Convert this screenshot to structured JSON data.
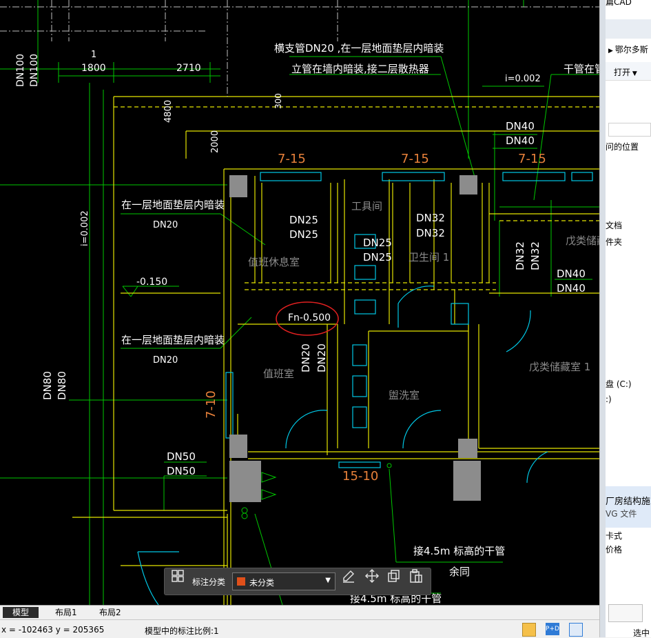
{
  "drawing": {
    "annotations": {
      "horiz_branch": "横支管DN20 ,在一层地面垫层内暗装",
      "riser": "立管在墙内暗装,接二层散热器",
      "main_pipe": "干管在管",
      "slope_top": "i=0.002",
      "slope_left": "i=0.002",
      "under_floor_1": "在一层地面垫层内暗装",
      "under_floor_2": "在一层地面垫层内暗装",
      "dn20_a": "DN20",
      "dn20_b": "DN20",
      "level_0150": "-0.150",
      "level_0500": "Fn-0.500",
      "connect_45m": "接4.5m 标高的干管",
      "same_below": "余同",
      "connect_45m_b": "接4.5m 标高的干管"
    },
    "dims": {
      "d1": "1",
      "d1800": "1800",
      "d2710": "2710",
      "d4800": "4800",
      "d300": "300",
      "d2000": "2000"
    },
    "pipes": {
      "dn100_a": "DN100",
      "dn100_b": "DN100",
      "dn40_a": "DN40",
      "dn40_b": "DN40",
      "dn25_a": "DN25",
      "dn25_b": "DN25",
      "dn32_a": "DN32",
      "dn32_b": "DN32",
      "dn25_c": "DN25",
      "dn25_d": "DN25",
      "dn32_v1": "DN32",
      "dn32_v2": "DN32",
      "dn40_c": "DN40",
      "dn40_d": "DN40",
      "dn20_v1": "DN20",
      "dn20_v2": "DN20",
      "dn80_a": "DN80",
      "dn80_b": "DN80",
      "dn50_a": "DN50",
      "dn50_b": "DN50"
    },
    "axes": {
      "a715_1": "7-15",
      "a715_2": "7-15",
      "a715_3": "7-15",
      "a710": "7-10",
      "a1510": "15-10"
    },
    "rooms": {
      "tool_room": "工具间",
      "toilet": "卫生间 1",
      "duty_rest": "值班休息室",
      "duty_room": "值班室",
      "washroom": "盥洗室",
      "storage_a": "戊类储藏",
      "storage_b": "戊类储藏室 1"
    }
  },
  "toolbar": {
    "label": "标注分类",
    "selected": "未分类",
    "swatch_color": "#e0501a",
    "icons": [
      "grid-icon",
      "edit-icon",
      "move-icon",
      "copy-icon",
      "paste-icon"
    ]
  },
  "tabs": [
    "模型",
    "布局1",
    "布局2"
  ],
  "status": {
    "coords": "x = -102463  y = 205365",
    "scale": "模型中的标注比例:1"
  },
  "right_panel": {
    "top_cut": "篇CAD",
    "breadcrumb": "鄂尔多斯",
    "open": "打开",
    "item1": "问的位置",
    "item2": "文档",
    "item3": "件夹",
    "item4": "盘 (C:)",
    "item5": ":)",
    "item6": "厂房结构施",
    "item7": "VG 文件",
    "item8": "卡式",
    "item9": "价格",
    "item10": "选中"
  },
  "colors": {
    "background": "#000000",
    "green": "#00c800",
    "yellow": "#e6e600",
    "cyan": "#00c8e6",
    "orange": "#e8813a",
    "red_circle": "#e02020"
  }
}
